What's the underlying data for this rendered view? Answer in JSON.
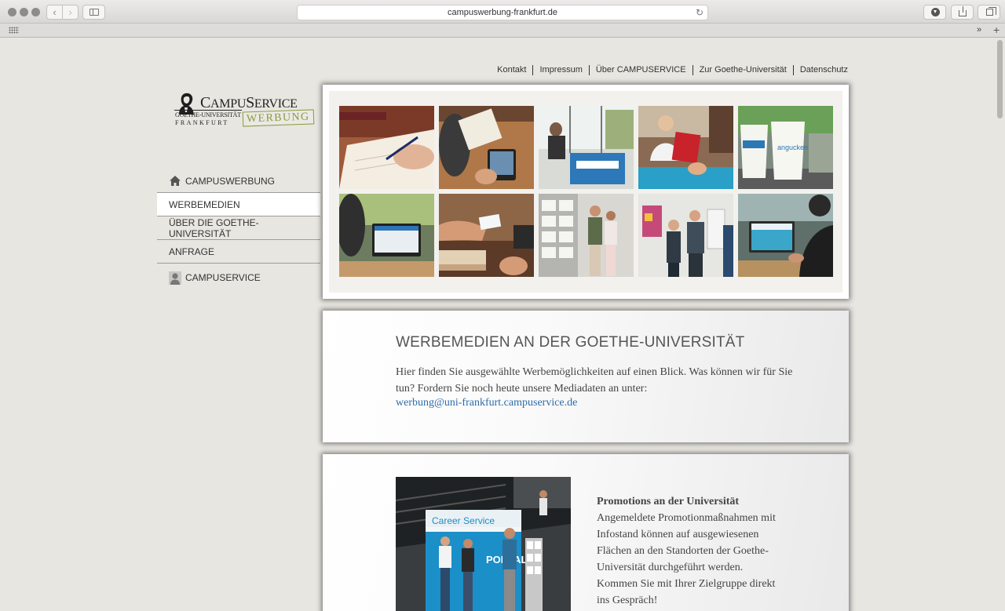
{
  "browser": {
    "url": "campuswerbung-frankfurt.de",
    "back_glyph": "‹",
    "forward_glyph": "›",
    "reload_glyph": "↻",
    "more_glyph": "»",
    "plus_glyph": "+"
  },
  "toplinks": [
    "Kontakt",
    "Impressum",
    "Über CAMPUSERVICE",
    "Zur Goethe-Universität",
    "Datenschutz"
  ],
  "logo": {
    "name_big1": "C",
    "name_small1": "AMPU",
    "name_big2": "S",
    "name_small2": "ERVICE",
    "sub1": "GOETHE-UNIVERSITÄT",
    "sub2": "FRANKFURT",
    "werbung": "WERBUNG"
  },
  "nav": {
    "items": [
      {
        "label": "CAMPUSWERBUNG",
        "icon": "home-icon"
      },
      {
        "label": "WERBEMEDIEN",
        "active": true
      },
      {
        "label": "ÜBER DIE GOETHE-UNIVERSITÄT"
      },
      {
        "label": "ANFRAGE"
      },
      {
        "label": "CAMPUSERVICE",
        "icon": "person-icon"
      }
    ]
  },
  "intro": {
    "title": "WERBEMEDIEN AN DER GOETHE-UNIVERSITÄT",
    "text": "Hier finden Sie ausgewählte Werbemöglichkeiten auf einen Blick. Was können wir für Sie tun? Fordern Sie noch heute unsere Mediadaten an unter:",
    "email": "werbung@uni-frankfurt.campuservice.de"
  },
  "promo": {
    "title": "Promotions an der Universität",
    "text": "Angemeldete Promotionmaßnahmen mit Infostand können auf ausgewiesenen Flächen an den Standorten der Goethe-Universität durchgeführt werden. Kommen Sie mit Ihrer Zielgruppe direkt ins Gespräch!",
    "booth_brand": "Career Service",
    "booth_sign": "PORTAL"
  },
  "gallery": {
    "cup_text": "angucken"
  },
  "colors": {
    "link": "#2c6ca8",
    "werbung_green": "#8a9a3a",
    "page_bg": "#e8e6e1"
  }
}
